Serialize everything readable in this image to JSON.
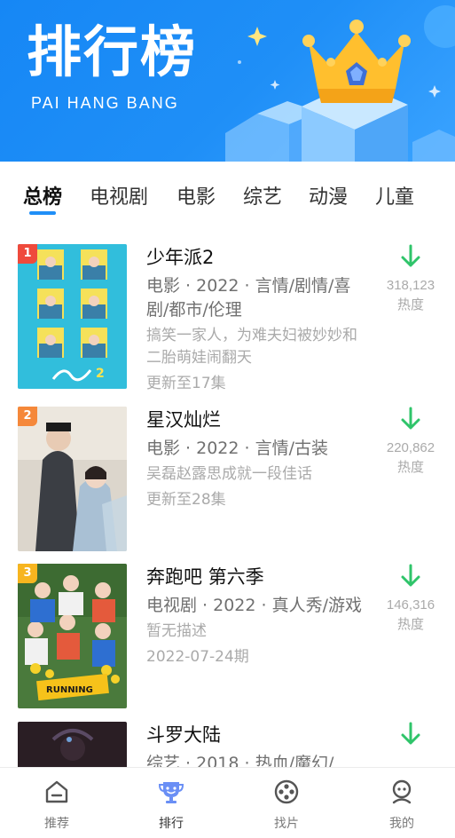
{
  "header": {
    "title": "排行榜",
    "subtitle": "PAI HANG BANG"
  },
  "tabs": [
    {
      "label": "总榜",
      "active": true
    },
    {
      "label": "电视剧",
      "active": false
    },
    {
      "label": "电影",
      "active": false
    },
    {
      "label": "综艺",
      "active": false
    },
    {
      "label": "动漫",
      "active": false
    },
    {
      "label": "儿童",
      "active": false
    }
  ],
  "items": [
    {
      "rank": "1",
      "rank_color": "#ef4a3c",
      "title": "少年派2",
      "meta": "电影 · 2022 · 言情/剧情/喜剧/都市/伦理",
      "description": "搞笑一家人，为难夫妇被妙妙和二胎萌娃闹翻天",
      "update": "更新至17集",
      "heat": "318,123",
      "heat_label": "热度",
      "trend": "down",
      "trend_color": "#2fc46a"
    },
    {
      "rank": "2",
      "rank_color": "#f5883a",
      "title": "星汉灿烂",
      "meta": "电影 · 2022 · 言情/古装",
      "description": "吴磊赵露思成就一段佳话",
      "update": "更新至28集",
      "heat": "220,862",
      "heat_label": "热度",
      "trend": "down",
      "trend_color": "#2fc46a"
    },
    {
      "rank": "3",
      "rank_color": "#f7b51f",
      "title": "奔跑吧 第六季",
      "meta": "电视剧 · 2022 · 真人秀/游戏",
      "description": "暂无描述",
      "update": "2022-07-24期",
      "heat": "146,316",
      "heat_label": "热度",
      "trend": "down",
      "trend_color": "#2fc46a"
    },
    {
      "rank": "",
      "rank_color": "",
      "title": "斗罗大陆",
      "meta": "综艺 · 2018 · 热血/魔幻/",
      "description": "",
      "update": "",
      "heat": "",
      "heat_label": "",
      "trend": "down",
      "trend_color": "#2fc46a"
    }
  ],
  "bottom_nav": [
    {
      "label": "推荐",
      "icon": "home-icon",
      "active": false
    },
    {
      "label": "排行",
      "icon": "trophy-icon",
      "active": true
    },
    {
      "label": "找片",
      "icon": "film-reel-icon",
      "active": false
    },
    {
      "label": "我的",
      "icon": "user-icon",
      "active": false
    }
  ],
  "colors": {
    "brand_blue": "#1f8ff7",
    "trend_down": "#2fc46a"
  }
}
